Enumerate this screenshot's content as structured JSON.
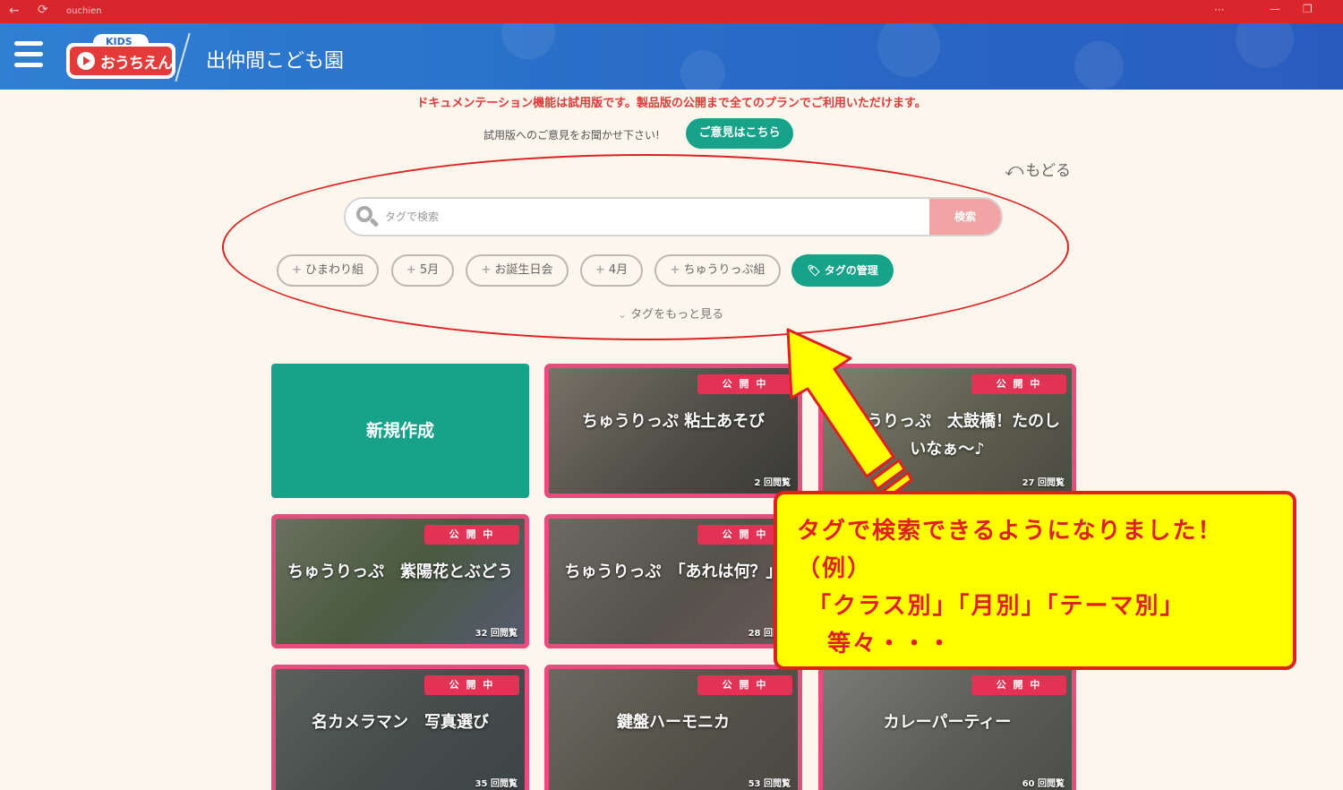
{
  "titlebar": {
    "title": "ouchien",
    "dots": "···",
    "back_glyph": "←",
    "reload_glyph": "⟳",
    "min_glyph": "—",
    "max_glyph": "❐"
  },
  "header": {
    "logo_top": "KIDS",
    "logo_brand": "おうちえん",
    "school_name": "出仲間こども園"
  },
  "notice": "ドキュメンテーション機能は試用版です。製品版の公開まで全てのプランでご利用いただけます。",
  "feedback": {
    "text": "試用版へのご意見をお聞かせ下さい!",
    "button": "ご意見はこちら"
  },
  "back_link": "もどる",
  "search": {
    "placeholder": "タグで検索",
    "button": "検索"
  },
  "tags": [
    "ひまわり組",
    "5月",
    "お誕生日会",
    "4月",
    "ちゅうりっぷ組"
  ],
  "tag_manage": "タグの管理",
  "more_tags": "タグをもっと見る",
  "new_card": "新規作成",
  "cards": [
    {
      "badge": "公 開 中",
      "title": "ちゅうりっぷ 粘土あそび",
      "views": "2 回閲覧",
      "color": "#5e5a52"
    },
    {
      "badge": "公 開 中",
      "title": "ちゅうりっぷ　太鼓橋！たのしいなぁ〜♪",
      "views": "27 回閲覧",
      "color": "#6a6a5a"
    },
    {
      "badge": "公 開 中",
      "title": "ちゅうりっぷ　紫陽花とぶどう",
      "views": "32 回閲覧",
      "color": "#4f5b48"
    },
    {
      "badge": "公 開 中",
      "title": "ちゅうりっぷ　「あれは何？」",
      "views": "28 回閲覧",
      "color": "#5a5650"
    },
    {
      "badge": "公 開 中",
      "title": "名カメラマン　写真選び",
      "views": "35 回閲覧",
      "color": "#4e5654"
    },
    {
      "badge": "公 開 中",
      "title": "鍵盤ハーモニカ",
      "views": "53 回閲覧",
      "color": "#5b5a52"
    },
    {
      "badge": "公 開 中",
      "title": "カレーパーティー",
      "views": "60 回閲覧",
      "color": "#636260"
    }
  ],
  "callout": {
    "line1": "タグで検索できるようになりました！",
    "line2": "（例）",
    "line3": "「クラス別」「月別」「テーマ別」",
    "line4": "等々・・・"
  },
  "colors": {
    "accent_green": "#17a38a",
    "header_blue": "#2a6bc7",
    "annotation_red": "#e02020",
    "callout_yellow": "#ffff00"
  }
}
